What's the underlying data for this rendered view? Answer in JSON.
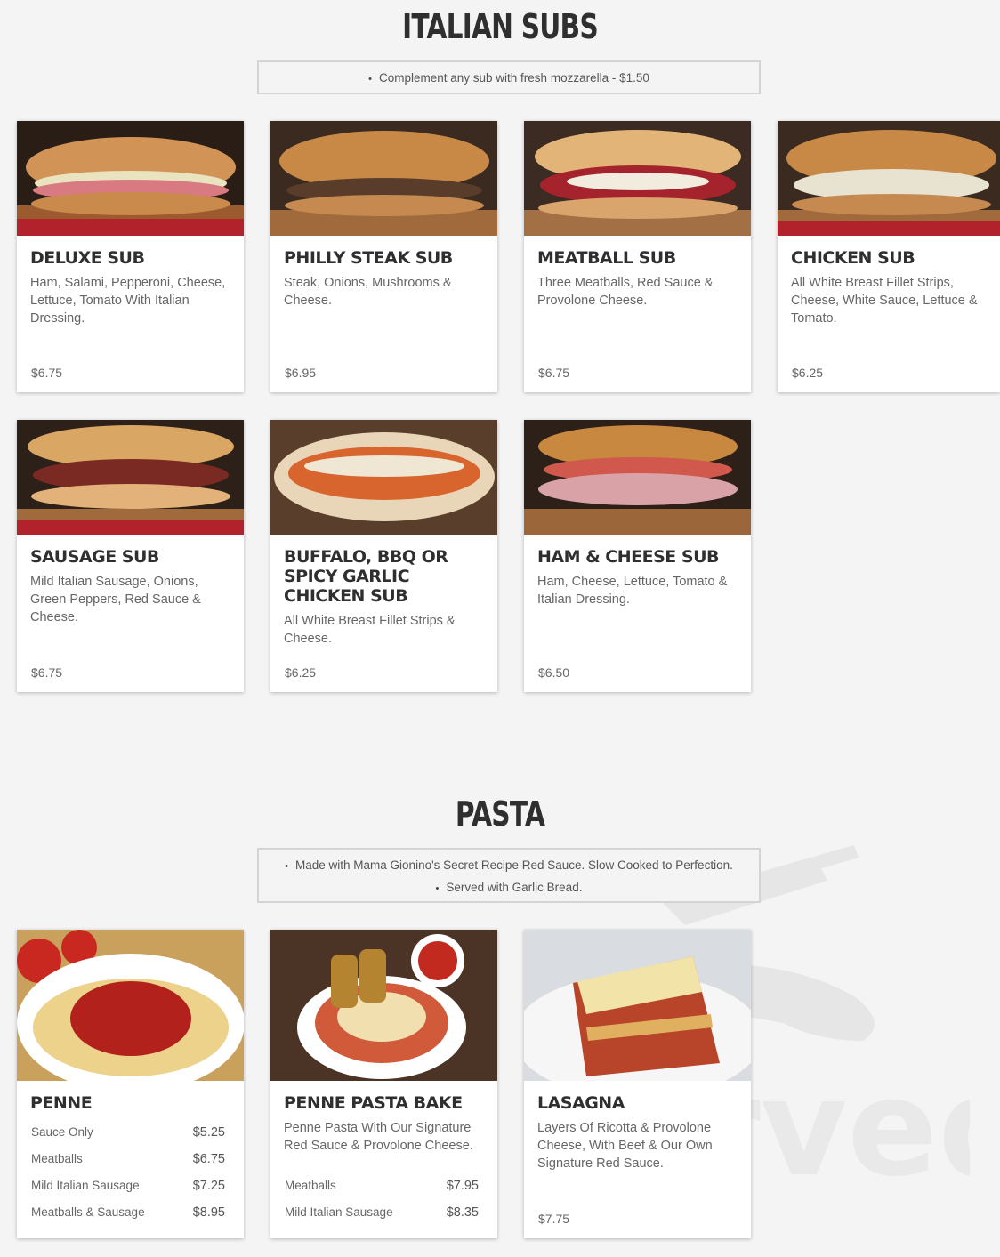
{
  "subs": {
    "title": "ITALIAN SUBS",
    "notes": [
      "Complement any sub with fresh mozzarella - $1.50"
    ],
    "items": [
      {
        "name": "DELUXE SUB",
        "desc": "Ham, Salami, Pepperoni, Cheese, Lettuce, Tomato With Italian Dressing.",
        "price": "$6.75"
      },
      {
        "name": "PHILLY STEAK SUB",
        "desc": "Steak, Onions, Mushrooms & Cheese.",
        "price": "$6.95"
      },
      {
        "name": "MEATBALL SUB",
        "desc": "Three Meatballs, Red Sauce & Provolone Cheese.",
        "price": "$6.75"
      },
      {
        "name": "CHICKEN SUB",
        "desc": "All White Breast Fillet Strips, Cheese, White Sauce, Lettuce & Tomato.",
        "price": "$6.25"
      },
      {
        "name": "SAUSAGE SUB",
        "desc": "Mild Italian Sausage, Onions, Green Peppers, Red Sauce & Cheese.",
        "price": "$6.75"
      },
      {
        "name": "BUFFALO, BBQ OR SPICY GARLIC CHICKEN SUB",
        "desc": "All White Breast Fillet Strips & Cheese.",
        "price": "$6.25"
      },
      {
        "name": "HAM & CHEESE SUB",
        "desc": "Ham, Cheese, Lettuce, Tomato & Italian Dressing.",
        "price": "$6.50"
      }
    ]
  },
  "pasta": {
    "title": "PASTA",
    "notes": [
      "Made with Mama Gionino's Secret Recipe Red Sauce. Slow Cooked to Perfection.",
      "Served with Garlic Bread."
    ],
    "items": [
      {
        "name": "PENNE",
        "options": [
          {
            "label": "Sauce Only",
            "price": "$5.25"
          },
          {
            "label": "Meatballs",
            "price": "$6.75"
          },
          {
            "label": "Mild Italian Sausage",
            "price": "$7.25"
          },
          {
            "label": "Meatballs & Sausage",
            "price": "$8.95"
          }
        ]
      },
      {
        "name": "PENNE PASTA BAKE",
        "desc": "Penne Pasta With Our Signature Red Sauce & Provolone Cheese.",
        "options": [
          {
            "label": "Meatballs",
            "price": "$7.95"
          },
          {
            "label": "Mild Italian Sausage",
            "price": "$8.35"
          }
        ]
      },
      {
        "name": "LASAGNA",
        "desc": "Layers Of Ricotta & Provolone Cheese, With Beef & Our Own Signature Red Sauce.",
        "price": "$7.75"
      }
    ]
  },
  "watermark": {
    "text": "sirved",
    "icon": "fork-knife-icon"
  },
  "colors": {
    "background": "#f4f4f4",
    "card": "#ffffff",
    "heading": "#2f2f2f",
    "text": "#666666",
    "border": "#d4d4d4"
  }
}
